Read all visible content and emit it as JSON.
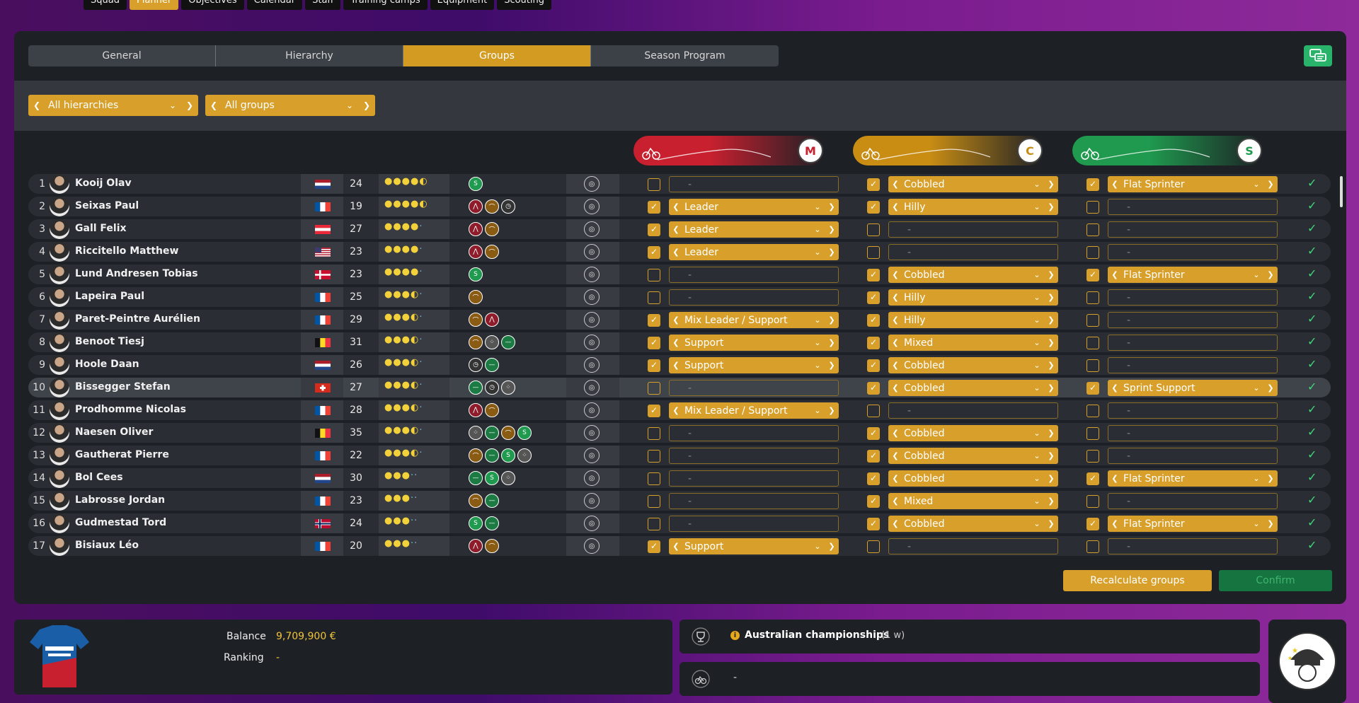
{
  "top_nav": [
    "Squad",
    "Planner",
    "Objectives",
    "Calendar",
    "Staff",
    "Training camps",
    "Equipment",
    "Scouting"
  ],
  "top_nav_active": 1,
  "tabs": [
    "General",
    "Hierarchy",
    "Groups",
    "Season Program"
  ],
  "active_tab": 2,
  "filters": {
    "hierarchy": "All hierarchies",
    "group": "All groups"
  },
  "column_groups": [
    {
      "id": "mountain",
      "icon": "mountain-climber-icon",
      "color": "#c8202f",
      "letter": "M"
    },
    {
      "id": "cobbles",
      "icon": "cobbles-icon",
      "color": "#c98d14",
      "letter": "C"
    },
    {
      "id": "sprint",
      "icon": "sprinter-icon",
      "color": "#1f9a4e",
      "letter": "S"
    }
  ],
  "riders": [
    {
      "num": "1",
      "name": "Kooij Olav",
      "flag": "NL",
      "age": "24",
      "stars": 4.5,
      "specs": [
        "sprint"
      ],
      "g1": false,
      "g1v": "-",
      "g2": true,
      "g2v": "Cobbled",
      "g3": true,
      "g3v": "Flat Sprinter"
    },
    {
      "num": "2",
      "name": "Seixas Paul",
      "flag": "FR",
      "age": "19",
      "stars": 4.5,
      "specs": [
        "mountain",
        "hill",
        "tt"
      ],
      "g1": true,
      "g1v": "Leader",
      "g2": true,
      "g2v": "Hilly",
      "g3": false,
      "g3v": "-"
    },
    {
      "num": "3",
      "name": "Gall Felix",
      "flag": "AT",
      "age": "27",
      "stars": 4,
      "specs": [
        "mountain",
        "hill"
      ],
      "g1": true,
      "g1v": "Leader",
      "g2": false,
      "g2v": "-",
      "g3": false,
      "g3v": "-"
    },
    {
      "num": "4",
      "name": "Riccitello Matthew",
      "flag": "US",
      "age": "23",
      "stars": 4,
      "specs": [
        "mountain",
        "hill"
      ],
      "g1": true,
      "g1v": "Leader",
      "g2": false,
      "g2v": "-",
      "g3": false,
      "g3v": "-"
    },
    {
      "num": "5",
      "name": "Lund Andresen Tobias",
      "flag": "DK",
      "age": "23",
      "stars": 4,
      "specs": [
        "sprint"
      ],
      "g1": false,
      "g1v": "-",
      "g2": true,
      "g2v": "Cobbled",
      "g3": true,
      "g3v": "Flat Sprinter"
    },
    {
      "num": "6",
      "name": "Lapeira Paul",
      "flag": "FR",
      "age": "25",
      "stars": 3.5,
      "specs": [
        "hill"
      ],
      "g1": false,
      "g1v": "-",
      "g2": true,
      "g2v": "Hilly",
      "g3": false,
      "g3v": "-"
    },
    {
      "num": "7",
      "name": "Paret-Peintre Aurélien",
      "flag": "FR",
      "age": "29",
      "stars": 3.5,
      "specs": [
        "hill",
        "mountain"
      ],
      "g1": true,
      "g1v": "Mix Leader / Support",
      "g2": true,
      "g2v": "Hilly",
      "g3": false,
      "g3v": "-"
    },
    {
      "num": "8",
      "name": "Benoot Tiesj",
      "flag": "BE",
      "age": "31",
      "stars": 3.5,
      "specs": [
        "hill",
        "cobbles",
        "flat"
      ],
      "g1": true,
      "g1v": "Support",
      "g2": true,
      "g2v": "Mixed",
      "g3": false,
      "g3v": "-"
    },
    {
      "num": "9",
      "name": "Hoole Daan",
      "flag": "NL",
      "age": "26",
      "stars": 3.5,
      "specs": [
        "tt",
        "flat"
      ],
      "g1": true,
      "g1v": "Support",
      "g2": true,
      "g2v": "Cobbled",
      "g3": false,
      "g3v": "-"
    },
    {
      "num": "10",
      "name": "Bissegger Stefan",
      "flag": "CH",
      "age": "27",
      "stars": 3.5,
      "specs": [
        "flat",
        "tt",
        "cobbles"
      ],
      "g1": false,
      "g1v": "-",
      "g2": true,
      "g2v": "Cobbled",
      "g3": true,
      "g3v": "Sprint Support"
    },
    {
      "num": "11",
      "name": "Prodhomme Nicolas",
      "flag": "FR",
      "age": "28",
      "stars": 3.5,
      "specs": [
        "mountain",
        "hill"
      ],
      "g1": true,
      "g1v": "Mix Leader / Support",
      "g2": false,
      "g2v": "-",
      "g3": false,
      "g3v": "-"
    },
    {
      "num": "12",
      "name": "Naesen Oliver",
      "flag": "BE",
      "age": "35",
      "stars": 3.5,
      "specs": [
        "cobbles",
        "flat",
        "hill",
        "sprint"
      ],
      "g1": false,
      "g1v": "-",
      "g2": true,
      "g2v": "Cobbled",
      "g3": false,
      "g3v": "-"
    },
    {
      "num": "13",
      "name": "Gautherat Pierre",
      "flag": "FR",
      "age": "22",
      "stars": 3.5,
      "specs": [
        "hill",
        "flat",
        "sprint",
        "cobbles"
      ],
      "g1": false,
      "g1v": "-",
      "g2": true,
      "g2v": "Cobbled",
      "g3": false,
      "g3v": "-"
    },
    {
      "num": "14",
      "name": "Bol Cees",
      "flag": "NL",
      "age": "30",
      "stars": 3,
      "specs": [
        "flat",
        "sprint",
        "cobbles"
      ],
      "g1": false,
      "g1v": "-",
      "g2": true,
      "g2v": "Cobbled",
      "g3": true,
      "g3v": "Flat Sprinter"
    },
    {
      "num": "15",
      "name": "Labrosse Jordan",
      "flag": "FR",
      "age": "23",
      "stars": 3,
      "specs": [
        "hill",
        "flat"
      ],
      "g1": false,
      "g1v": "-",
      "g2": true,
      "g2v": "Mixed",
      "g3": false,
      "g3v": "-"
    },
    {
      "num": "16",
      "name": "Gudmestad Tord",
      "flag": "NO",
      "age": "24",
      "stars": 3,
      "specs": [
        "sprint",
        "flat"
      ],
      "g1": false,
      "g1v": "-",
      "g2": true,
      "g2v": "Cobbled",
      "g3": true,
      "g3v": "Flat Sprinter"
    },
    {
      "num": "17",
      "name": "Bisiaux Léo",
      "flag": "FR",
      "age": "20",
      "stars": 3,
      "specs": [
        "mountain",
        "hill"
      ],
      "g1": true,
      "g1v": "Support",
      "g2": false,
      "g2v": "-",
      "g3": false,
      "g3v": "-"
    }
  ],
  "selected_row": 9,
  "buttons": {
    "recalculate": "Recalculate groups",
    "confirm": "Confirm"
  },
  "footer": {
    "balance_label": "Balance",
    "balance_value": "9,709,900 €",
    "ranking_label": "Ranking",
    "ranking_value": "-",
    "event_name": "Australian championships",
    "event_time": "(1 w)",
    "event2": "-"
  }
}
